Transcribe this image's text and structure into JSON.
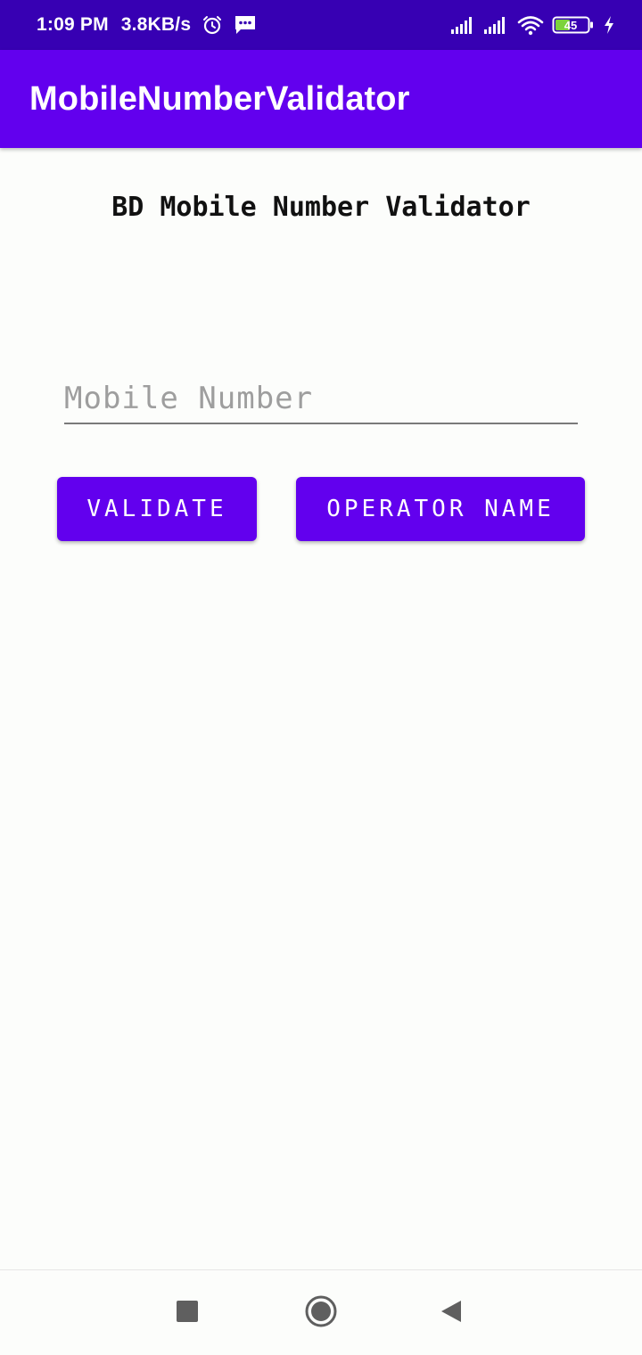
{
  "status_bar": {
    "time": "1:09 PM",
    "network_speed": "3.8KB/s",
    "battery_level": "45",
    "icons": [
      "alarm-icon",
      "message-icon",
      "signal-icon",
      "signal-icon",
      "wifi-icon",
      "battery-icon",
      "charging-icon"
    ]
  },
  "app_bar": {
    "title": "MobileNumberValidator"
  },
  "main": {
    "heading": "BD Mobile Number Validator",
    "mobile_input": {
      "placeholder": "Mobile Number",
      "value": ""
    },
    "validate_label": "VALIDATE",
    "operator_label": "OPERATOR NAME"
  },
  "nav_bar": {
    "icons": [
      "recents-icon",
      "home-icon",
      "back-icon"
    ]
  },
  "colors": {
    "status_bar": "#3700b3",
    "primary": "#6200ee",
    "background": "#fcfdfb",
    "placeholder": "#9e9e9e"
  }
}
